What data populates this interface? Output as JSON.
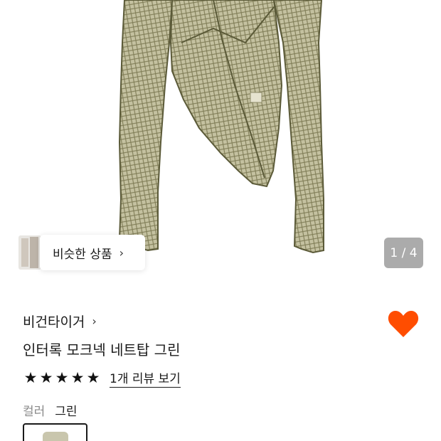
{
  "gallery": {
    "similar_label": "비슷한 상품",
    "page_indicator": "1 / 4"
  },
  "product": {
    "brand": "비건타이거",
    "title": "인터록 모크넥 네트탑 그린",
    "rating_stars": 5,
    "review_link": "1개 리뷰 보기",
    "color_label": "컬러",
    "color_value": "그린"
  },
  "colors": {
    "heart": "#ff4d00",
    "fabric": "#b7b48f",
    "fabric_dark": "#6d6a47"
  },
  "icons": {
    "chevron": "›",
    "star": "★"
  }
}
